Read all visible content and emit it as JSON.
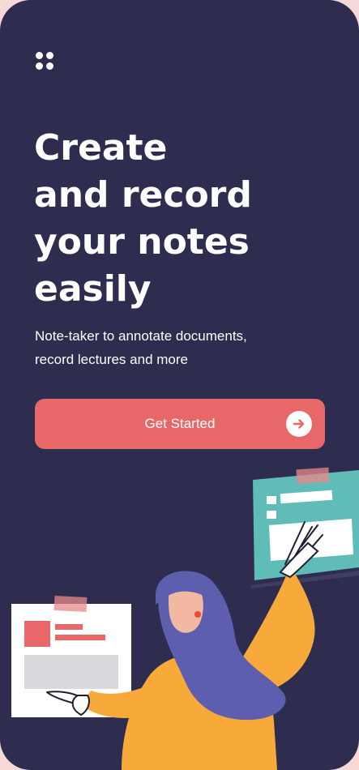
{
  "header": {
    "menu_icon": "grid-dots-icon"
  },
  "hero": {
    "title_lines": [
      "Create",
      "and record",
      "your notes",
      "easily"
    ],
    "subtitle_lines": [
      "Note-taker to annotate documents,",
      "record lectures and more"
    ]
  },
  "cta": {
    "label": "Get Started",
    "icon": "arrow-right-icon"
  },
  "illustration": {
    "name": "woman-with-notes-illustration"
  },
  "colors": {
    "background": "#2e2c4f",
    "accent": "#e8686a",
    "teal": "#5fbcb7",
    "yellow": "#f7a93a",
    "purple": "#5d5fae",
    "text": "#ffffff"
  }
}
